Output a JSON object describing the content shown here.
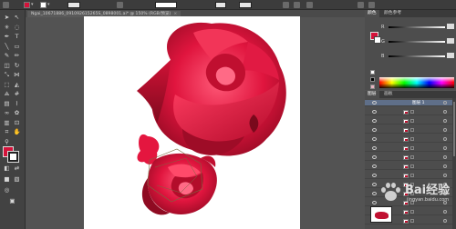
{
  "control_bar": {
    "fill_color": "#d4123a",
    "stroke_width_label": "",
    "opacity_label": "",
    "style_label": "",
    "icons": [
      "path-icon",
      "fill-swatch-icon",
      "stroke-swatch-icon",
      "brush-icon",
      "style-icon",
      "align-icon",
      "transform-icon"
    ]
  },
  "document_tab": {
    "title": "Ngai_10671886_091092615265S_0898001.ai* @ 150% (RGB/预览)",
    "close_label": "×"
  },
  "tools": {
    "fill_color": "#d4123a",
    "stroke_color": "#ffffff",
    "items": [
      {
        "name": "selection-tool-icon",
        "glyph": "➤"
      },
      {
        "name": "direct-selection-tool-icon",
        "glyph": "↖"
      },
      {
        "name": "magic-wand-tool-icon",
        "glyph": "✳"
      },
      {
        "name": "lasso-tool-icon",
        "glyph": "◌"
      },
      {
        "name": "pen-tool-icon",
        "glyph": "✒"
      },
      {
        "name": "type-tool-icon",
        "glyph": "T"
      },
      {
        "name": "line-tool-icon",
        "glyph": "╲"
      },
      {
        "name": "rectangle-tool-icon",
        "glyph": "▭"
      },
      {
        "name": "paintbrush-tool-icon",
        "glyph": "✎"
      },
      {
        "name": "pencil-tool-icon",
        "glyph": "✏"
      },
      {
        "name": "eraser-tool-icon",
        "glyph": "◫"
      },
      {
        "name": "rotate-tool-icon",
        "glyph": "↻"
      },
      {
        "name": "scale-tool-icon",
        "glyph": "⤡"
      },
      {
        "name": "width-tool-icon",
        "glyph": "⋈"
      },
      {
        "name": "free-transform-tool-icon",
        "glyph": "⬚"
      },
      {
        "name": "shape-builder-tool-icon",
        "glyph": "◭"
      },
      {
        "name": "perspective-tool-icon",
        "glyph": "⟁"
      },
      {
        "name": "mesh-tool-icon",
        "glyph": "#"
      },
      {
        "name": "gradient-tool-icon",
        "glyph": "▤"
      },
      {
        "name": "eyedropper-tool-icon",
        "glyph": "⌇"
      },
      {
        "name": "blend-tool-icon",
        "glyph": "∞"
      },
      {
        "name": "symbol-sprayer-tool-icon",
        "glyph": "✿"
      },
      {
        "name": "graph-tool-icon",
        "glyph": "▥"
      },
      {
        "name": "artboard-tool-icon",
        "glyph": "⊡"
      },
      {
        "name": "slice-tool-icon",
        "glyph": "⌗"
      },
      {
        "name": "hand-tool-icon",
        "glyph": "✋"
      },
      {
        "name": "zoom-tool-icon",
        "glyph": "⚲"
      }
    ]
  },
  "color_panel": {
    "tabs": [
      "颜色",
      "颜色参考"
    ],
    "channels": [
      {
        "label": "R"
      },
      {
        "label": "G"
      },
      {
        "label": "B"
      }
    ],
    "fill_color": "#d4123a",
    "stroke_color": "#ffffff",
    "swatch_colors": [
      "#ffffff",
      "#000000",
      "#e8b4c0"
    ]
  },
  "layers_panel": {
    "tabs": [
      "图层",
      "画板"
    ],
    "layer_name": "图层 1",
    "rows": 14,
    "selected_row": 0
  },
  "watermark": {
    "text": "Bai经验",
    "sub": "jingyan.baidu.com"
  },
  "artwork": {
    "rose_colors": [
      "#f0234e",
      "#c30d2e",
      "#8f0a22",
      "#ff4a6a"
    ],
    "artboard_background": "#ffffff"
  }
}
